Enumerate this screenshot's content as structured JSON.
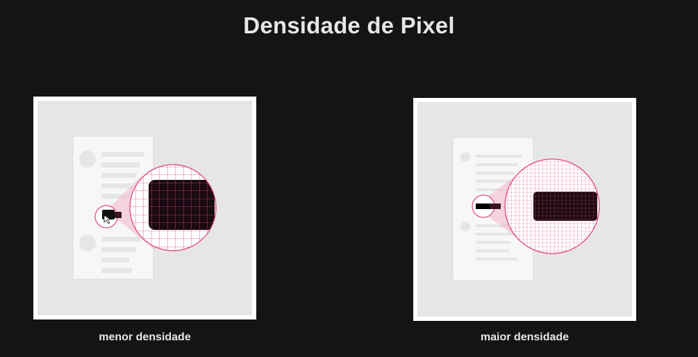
{
  "title": "Densidade de Pixel",
  "panels": [
    {
      "caption": "menor densidade",
      "density": "low"
    },
    {
      "caption": "maior densidade",
      "density": "high"
    }
  ],
  "colors": {
    "background": "#141416",
    "panel_border": "#ffffff",
    "panel_fill": "#e6e6e6",
    "grid_pink": "#e0457b",
    "cone_pink": "#f4b6cb",
    "pixel_dark": "#1a0a12"
  }
}
